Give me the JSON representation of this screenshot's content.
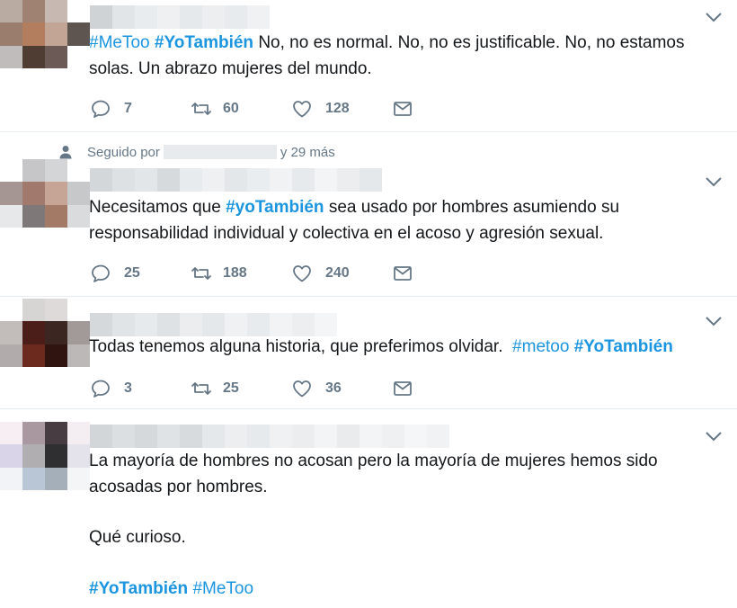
{
  "colors": {
    "hashtag": "#1b95e0",
    "action": "#657786",
    "divider": "#e6ecf0"
  },
  "icons": {
    "reply": "reply-icon",
    "retweet": "retweet-icon",
    "like": "heart-icon",
    "message": "envelope-icon",
    "menu": "chevron-down-icon",
    "followed": "person-icon"
  },
  "tweets": [
    {
      "text": [
        {
          "t": "#MeToo",
          "hash": true,
          "bold": false
        },
        {
          "t": " ",
          "hash": false,
          "bold": false
        },
        {
          "t": "#YoTambién",
          "hash": true,
          "bold": true
        },
        {
          "t": " No, no es normal. No, no es justificable. No, no estamos solas. Un abrazo mujeres del mundo.",
          "hash": false,
          "bold": false
        }
      ],
      "replies": "7",
      "retweets": "60",
      "likes": "128"
    },
    {
      "followed_prefix": "Seguido por",
      "followed_suffix": "y 29 más",
      "text": [
        {
          "t": "Necesitamos que ",
          "hash": false,
          "bold": false
        },
        {
          "t": "#yoTambién",
          "hash": true,
          "bold": true
        },
        {
          "t": " sea usado por hombres asumiendo su responsabilidad individual y colectiva en el acoso y agresión sexual.",
          "hash": false,
          "bold": false
        }
      ],
      "replies": "25",
      "retweets": "188",
      "likes": "240"
    },
    {
      "text": [
        {
          "t": "Todas tenemos alguna historia, que preferimos olvidar.  ",
          "hash": false,
          "bold": false
        },
        {
          "t": "#metoo",
          "hash": true,
          "bold": false
        },
        {
          "t": " ",
          "hash": false,
          "bold": false
        },
        {
          "t": "#YoTambién",
          "hash": true,
          "bold": true
        }
      ],
      "replies": "3",
      "retweets": "25",
      "likes": "36"
    },
    {
      "paragraph1": "La mayoría de hombres no acosan pero la mayoría de mujeres hemos sido acosadas por hombres.",
      "paragraph2": "Qué curioso.",
      "tag1": "#YoTambién",
      "tag2": "#MeToo"
    }
  ]
}
